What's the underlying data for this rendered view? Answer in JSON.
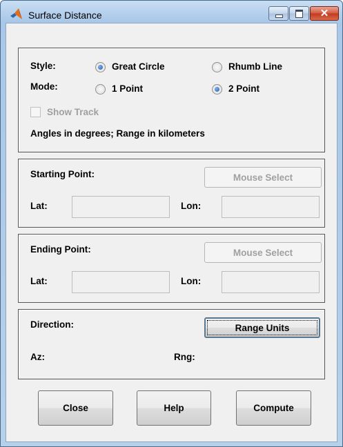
{
  "window": {
    "title": "Surface Distance",
    "icon": "matlab-icon",
    "controls": {
      "minimize": "minimize-icon",
      "maximize": "maximize-icon",
      "close": "✕"
    }
  },
  "options": {
    "style_label": "Style:",
    "style_options": [
      "Great Circle",
      "Rhumb Line"
    ],
    "style_selected": "Great Circle",
    "mode_label": "Mode:",
    "mode_options": [
      "1 Point",
      "2 Point"
    ],
    "mode_selected": "2 Point",
    "show_track_label": "Show Track",
    "show_track_checked": false,
    "units_note": "Angles in degrees;  Range in kilometers"
  },
  "starting_point": {
    "label": "Starting Point:",
    "mouse_select_label": "Mouse Select",
    "lat_label": "Lat:",
    "lat_value": "",
    "lon_label": "Lon:",
    "lon_value": ""
  },
  "ending_point": {
    "label": "Ending Point:",
    "mouse_select_label": "Mouse Select",
    "lat_label": "Lat:",
    "lat_value": "",
    "lon_label": "Lon:",
    "lon_value": ""
  },
  "direction": {
    "label": "Direction:",
    "range_units_label": "Range Units",
    "az_label": "Az:",
    "rng_label": "Rng:"
  },
  "footer": {
    "close_label": "Close",
    "help_label": "Help",
    "compute_label": "Compute"
  },
  "colors": {
    "radio_selected": "#1c5fb3",
    "close_button": "#c23a1d",
    "disabled_text": "#a0a0a0"
  }
}
